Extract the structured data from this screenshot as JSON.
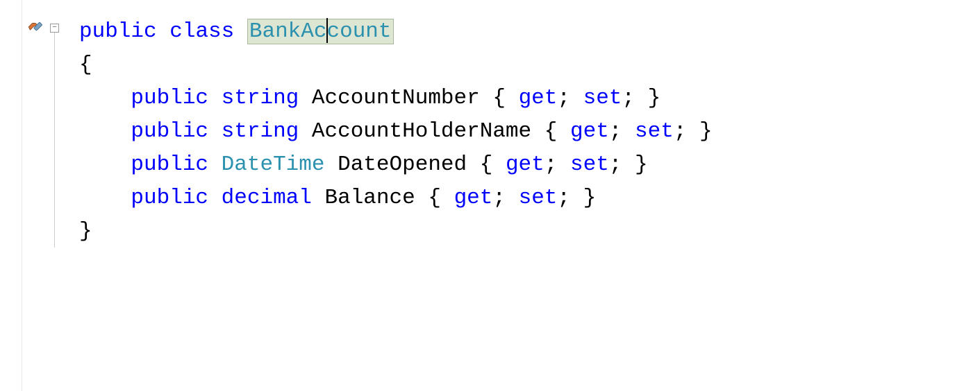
{
  "code": {
    "line1": {
      "kw_public": "public",
      "kw_class": "class",
      "class_name_part1": "BankAc",
      "class_name_part2": "count"
    },
    "line2": {
      "brace_open": "{"
    },
    "line3": {
      "kw_public": "public",
      "type": "string",
      "name": "AccountNumber",
      "accessor_open": "{",
      "get": "get",
      "set": "set",
      "semi": ";",
      "accessor_close": "}"
    },
    "line4": {
      "kw_public": "public",
      "type": "string",
      "name": "AccountHolderName",
      "accessor_open": "{",
      "get": "get",
      "set": "set",
      "semi": ";",
      "accessor_close": "}"
    },
    "line5": {
      "kw_public": "public",
      "type": "DateTime",
      "name": "DateOpened",
      "accessor_open": "{",
      "get": "get",
      "set": "set",
      "semi": ";",
      "accessor_close": "}"
    },
    "line6": {
      "kw_public": "public",
      "type": "decimal",
      "name": "Balance",
      "accessor_open": "{",
      "get": "get",
      "set": "set",
      "semi": ";",
      "accessor_close": "}"
    },
    "line7": {
      "brace_close": "}"
    }
  },
  "icons": {
    "fold_glyph": "−"
  }
}
